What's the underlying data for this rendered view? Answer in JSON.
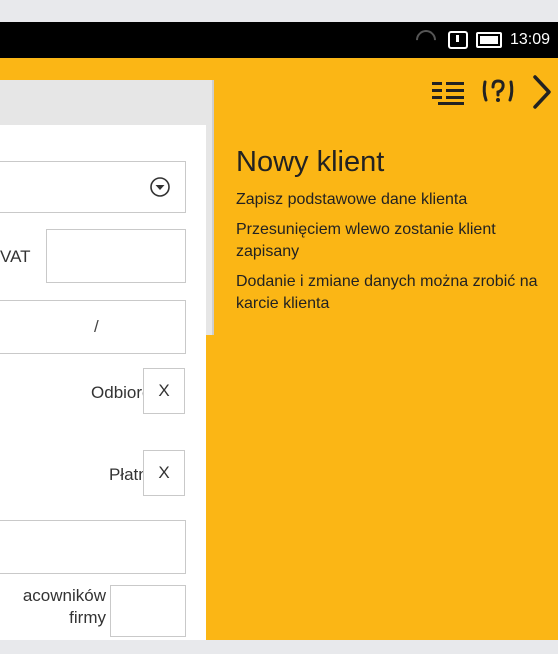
{
  "status_bar": {
    "time": "13:09",
    "icons": [
      "wifi-icon",
      "alert-icon",
      "battery-icon"
    ]
  },
  "action_bar": {
    "icons": [
      "list-icon",
      "help-footsteps-icon",
      "next-arrow-icon"
    ]
  },
  "form": {
    "vat_label": "VAT",
    "vat_value": "",
    "slash_value": "/",
    "odbiorca_label": "Odbiorca",
    "odbiorca_value": "X",
    "platnik_label": "Płatnik",
    "platnik_value": "X",
    "blank_value": "",
    "pracownikow_label_line1": "acowników",
    "pracownikow_label_line2": "firmy",
    "pracownikow_value": ""
  },
  "info": {
    "title": "Nowy klient",
    "line1": "Zapisz podstawowe dane klienta",
    "line2": "Przesunięciem wlewo zostanie klient zapisany",
    "line3": "Dodanie i zmiane danych można zrobić na karcie klienta"
  },
  "colors": {
    "accent": "#fbb615",
    "status_bar": "#000000",
    "panel": "#e6e6e6"
  }
}
